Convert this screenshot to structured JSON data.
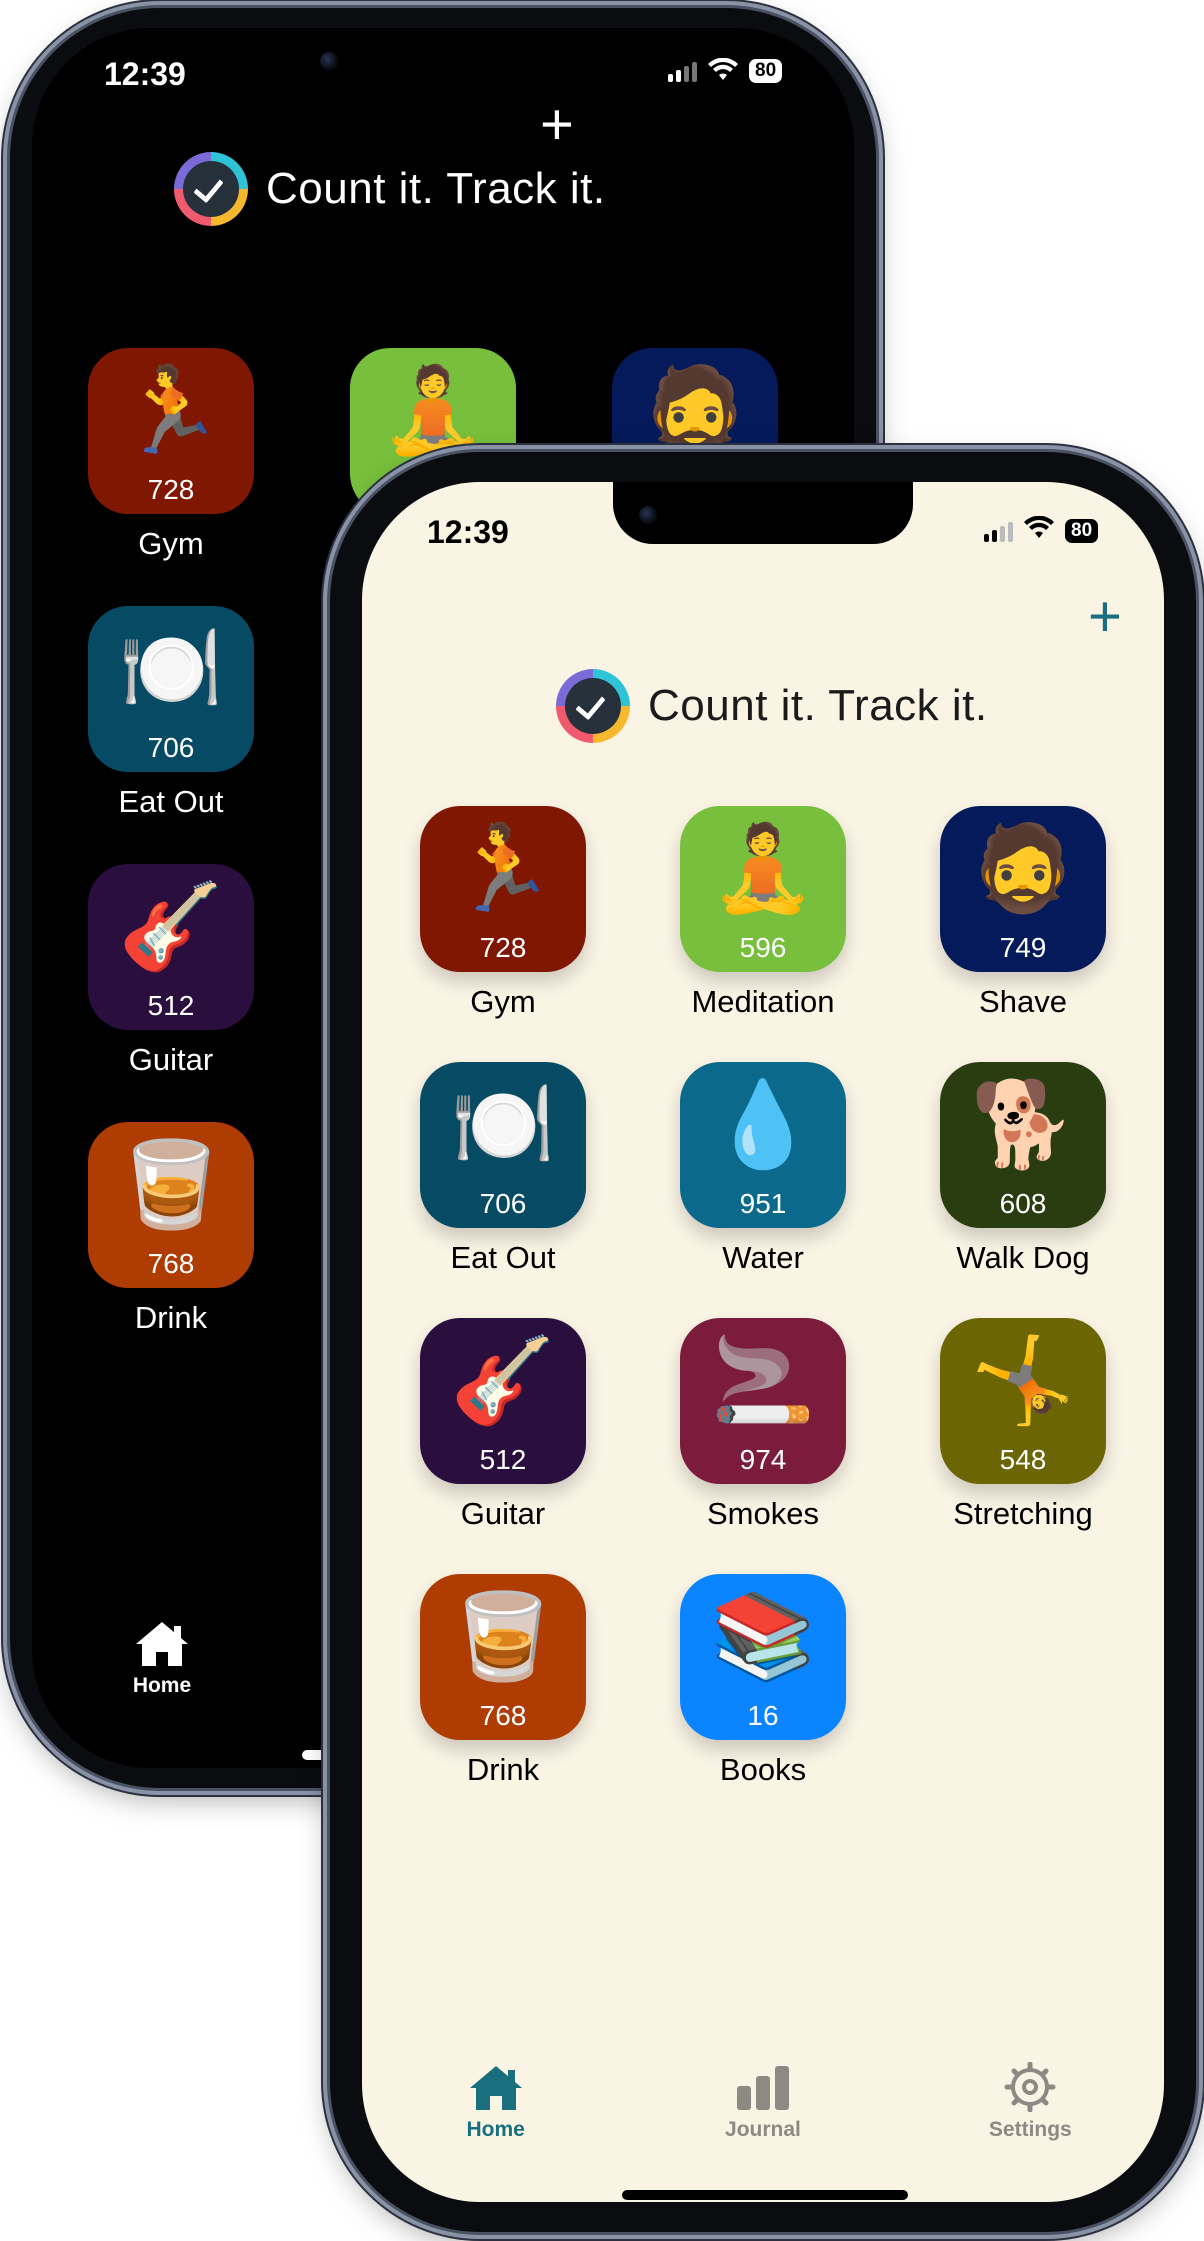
{
  "app": {
    "title": "Count it. Track it.",
    "add_icon": "plus-icon"
  },
  "dark_phone": {
    "time": "12:39",
    "battery": "80",
    "tiles": [
      {
        "emoji": "🏃",
        "count": "728",
        "label": "Gym",
        "color": "#7f1703"
      },
      {
        "emoji": "🧘",
        "count": "",
        "label": "",
        "color": "#77bf3c"
      },
      {
        "emoji": "🧔",
        "count": "",
        "label": "",
        "color": "#041a5a"
      },
      {
        "emoji": "🍽️",
        "count": "706",
        "label": "Eat Out",
        "color": "#064a64"
      },
      {
        "emoji": "🎸",
        "count": "512",
        "label": "Guitar",
        "color": "#2a0e3e"
      },
      {
        "emoji": "🥃",
        "count": "768",
        "label": "Drink",
        "color": "#ae3c03"
      }
    ],
    "tabs": [
      {
        "label": "Home",
        "icon": "house-icon"
      }
    ]
  },
  "light_phone": {
    "time": "12:39",
    "battery": "80",
    "tiles": [
      {
        "emoji": "🏃",
        "count": "728",
        "label": "Gym",
        "color": "#7f1703"
      },
      {
        "emoji": "🧘",
        "count": "596",
        "label": "Meditation",
        "color": "#77bf3c"
      },
      {
        "emoji": "🧔",
        "count": "749",
        "label": "Shave",
        "color": "#041a5a"
      },
      {
        "emoji": "🍽️",
        "count": "706",
        "label": "Eat Out",
        "color": "#064a64"
      },
      {
        "emoji": "💧",
        "count": "951",
        "label": "Water",
        "color": "#0b6a8b"
      },
      {
        "emoji": "🐕",
        "count": "608",
        "label": "Walk Dog",
        "color": "#293d11"
      },
      {
        "emoji": "🎸",
        "count": "512",
        "label": "Guitar",
        "color": "#2a0e3e"
      },
      {
        "emoji": "🚬",
        "count": "974",
        "label": "Smokes",
        "color": "#7b1c3c"
      },
      {
        "emoji": "🤸",
        "count": "548",
        "label": "Stretching",
        "color": "#6b6503"
      },
      {
        "emoji": "🥃",
        "count": "768",
        "label": "Drink",
        "color": "#ae3c03"
      },
      {
        "emoji": "📚",
        "count": "16",
        "label": "Books",
        "color": "#0a84ff"
      }
    ],
    "tabs": [
      {
        "label": "Home",
        "icon": "house-icon",
        "active": true
      },
      {
        "label": "Journal",
        "icon": "bar-chart-icon",
        "active": false
      },
      {
        "label": "Settings",
        "icon": "gear-icon",
        "active": false
      }
    ]
  },
  "colors": {
    "accent": "#1a6f7f",
    "light_bg": "#faf4e5",
    "dark_bg": "#000000",
    "inactive_tab": "#8c8a82"
  }
}
